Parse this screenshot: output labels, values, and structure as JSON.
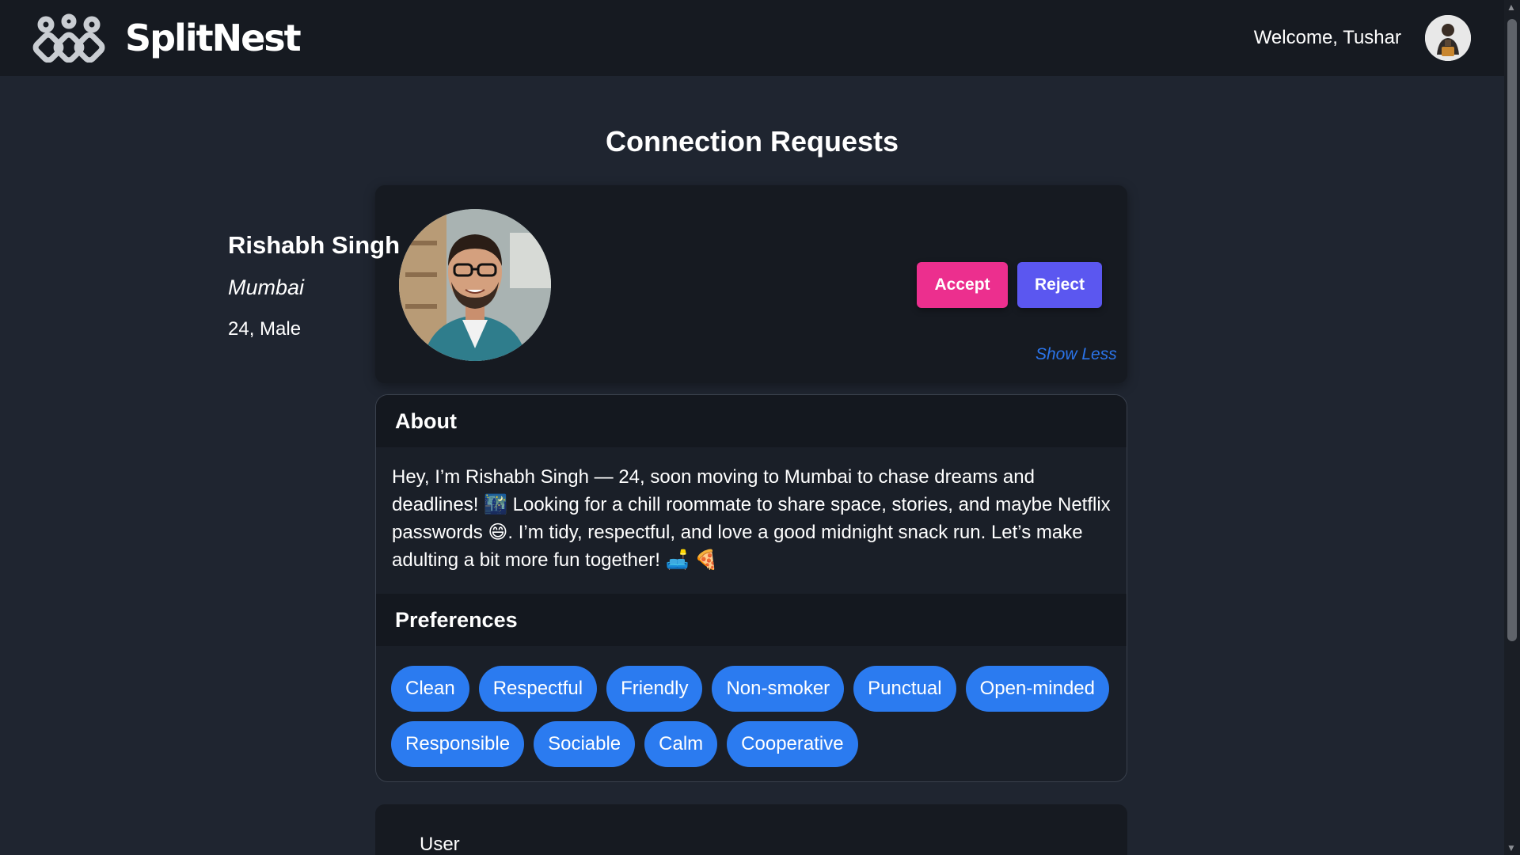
{
  "app": {
    "brand": "SplitNest",
    "welcome_text": "Welcome, Tushar"
  },
  "page": {
    "title": "Connection Requests"
  },
  "request": {
    "name": "Rishabh Singh",
    "city": "Mumbai",
    "age_gender": "24, Male",
    "accept_label": "Accept",
    "reject_label": "Reject",
    "toggle_label": "Show Less",
    "about_heading": "About",
    "about_text": "Hey, I’m Rishabh Singh — 24, soon moving to Mumbai to chase dreams and deadlines! 🌃 Looking for a chill roommate to share space, stories, and maybe Netflix passwords 😄. I’m tidy, respectful, and love a good midnight snack run. Let’s make adulting a bit more fun together! 🛋️ 🍕",
    "preferences_heading": "Preferences",
    "preferences": [
      "Clean",
      "Respectful",
      "Friendly",
      "Non-smoker",
      "Punctual",
      "Open-minded",
      "Responsible",
      "Sociable",
      "Calm",
      "Cooperative"
    ]
  },
  "next_request": {
    "partial_label": "User"
  },
  "colors": {
    "accept": "#ec2f8e",
    "reject": "#5b57f0",
    "tag": "#2b7bf0",
    "link": "#2b74ea",
    "navbar": "#161a21",
    "background": "#1f2530"
  },
  "icons": {
    "logo": "rings-logo-icon",
    "scroll_up": "▲",
    "scroll_down": "▼"
  }
}
